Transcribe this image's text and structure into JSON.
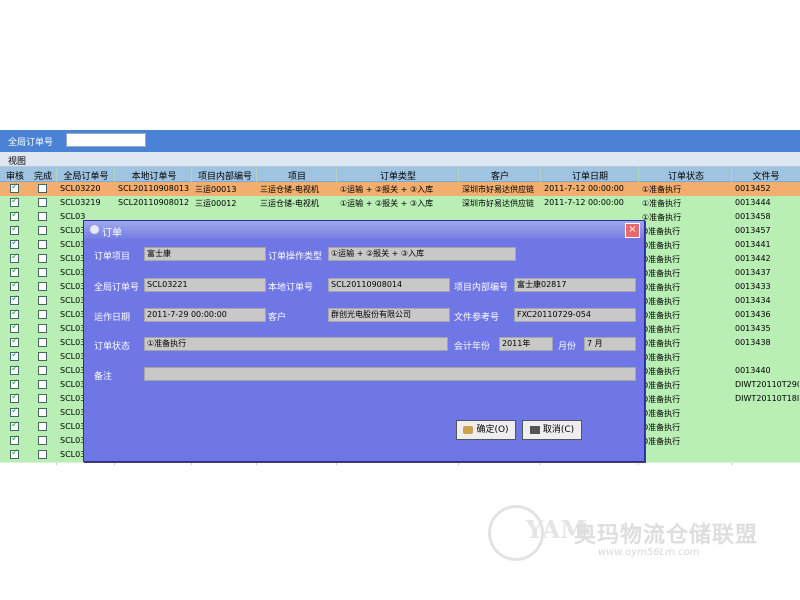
{
  "toolbar": {
    "label": "全局订单号",
    "value": ""
  },
  "menu": {
    "view": "视图"
  },
  "grid": {
    "columns": [
      "审核",
      "完成",
      "全局订单号",
      "本地订单号",
      "项目内部编号",
      "项目",
      "订单类型",
      "客户",
      "订单日期",
      "订单状态",
      "文件号"
    ],
    "rows": [
      {
        "audit": true,
        "done": false,
        "global": "SCL03220",
        "local": "SCL20110908013",
        "proj_no": "三运00013",
        "project": "三运仓储-电视机",
        "type": "①运输 + ②报关 + ③入库",
        "customer": "深圳市好易达供应链",
        "date": "2011-7-12 00:00:00",
        "status": "①准备执行",
        "file": "0013452"
      },
      {
        "audit": true,
        "done": false,
        "global": "SCL03219",
        "local": "SCL20110908012",
        "proj_no": "三运00012",
        "project": "三运仓储-电视机",
        "type": "①运输 + ②报关 + ③入库",
        "customer": "深圳市好易达供应链",
        "date": "2011-7-12 00:00:00",
        "status": "①准备执行",
        "file": "0013444"
      },
      {
        "audit": true,
        "done": false,
        "global": "SCL03",
        "local": "",
        "proj_no": "",
        "project": "",
        "type": "",
        "customer": "",
        "date": "",
        "status": "①准备执行",
        "file": "0013458"
      },
      {
        "audit": true,
        "done": false,
        "global": "SCL03",
        "local": "",
        "proj_no": "",
        "project": "",
        "type": "",
        "customer": "",
        "date": "",
        "status": "D准备执行",
        "file": "0013457"
      },
      {
        "audit": true,
        "done": false,
        "global": "SCL03",
        "local": "",
        "proj_no": "",
        "project": "",
        "type": "",
        "customer": "",
        "date": "",
        "status": "D准备执行",
        "file": "0013441"
      },
      {
        "audit": true,
        "done": false,
        "global": "SCL03",
        "local": "",
        "proj_no": "",
        "project": "",
        "type": "",
        "customer": "",
        "date": "",
        "status": "D准备执行",
        "file": "0013442"
      },
      {
        "audit": true,
        "done": false,
        "global": "SCL03",
        "local": "",
        "proj_no": "",
        "project": "",
        "type": "",
        "customer": "",
        "date": "",
        "status": "D准备执行",
        "file": "0013437"
      },
      {
        "audit": true,
        "done": false,
        "global": "SCL03",
        "local": "",
        "proj_no": "",
        "project": "",
        "type": "",
        "customer": "",
        "date": "",
        "status": "D准备执行",
        "file": "0013433"
      },
      {
        "audit": true,
        "done": false,
        "global": "SCL03",
        "local": "",
        "proj_no": "",
        "project": "",
        "type": "",
        "customer": "",
        "date": "",
        "status": "D准备执行",
        "file": "0013434"
      },
      {
        "audit": true,
        "done": false,
        "global": "SCL03",
        "local": "",
        "proj_no": "",
        "project": "",
        "type": "",
        "customer": "",
        "date": "",
        "status": "D准备执行",
        "file": "0013436"
      },
      {
        "audit": true,
        "done": false,
        "global": "SCL03",
        "local": "",
        "proj_no": "",
        "project": "",
        "type": "",
        "customer": "",
        "date": "",
        "status": "D准备执行",
        "file": "0013435"
      },
      {
        "audit": true,
        "done": false,
        "global": "SCL03",
        "local": "",
        "proj_no": "",
        "project": "",
        "type": "",
        "customer": "",
        "date": "",
        "status": "D准备执行",
        "file": "0013438"
      },
      {
        "audit": true,
        "done": false,
        "global": "SCL03",
        "local": "",
        "proj_no": "",
        "project": "",
        "type": "",
        "customer": "",
        "date": "",
        "status": "D准备执行",
        "file": ""
      },
      {
        "audit": true,
        "done": false,
        "global": "SCL03",
        "local": "",
        "proj_no": "",
        "project": "",
        "type": "",
        "customer": "",
        "date": "",
        "status": "D准备执行",
        "file": "0013440"
      },
      {
        "audit": true,
        "done": false,
        "global": "SCL03",
        "local": "",
        "proj_no": "",
        "project": "",
        "type": "",
        "customer": "",
        "date": "",
        "status": "D准备执行",
        "file": "DIWT20110T290-"
      },
      {
        "audit": true,
        "done": false,
        "global": "SCL03",
        "local": "",
        "proj_no": "",
        "project": "",
        "type": "",
        "customer": "",
        "date": "",
        "status": "D准备执行",
        "file": "DIWT20110T18I-"
      },
      {
        "audit": true,
        "done": false,
        "global": "SCL03",
        "local": "",
        "proj_no": "",
        "project": "",
        "type": "",
        "customer": "",
        "date": "",
        "status": "D准备执行",
        "file": ""
      },
      {
        "audit": true,
        "done": false,
        "global": "SCL03",
        "local": "",
        "proj_no": "",
        "project": "",
        "type": "",
        "customer": "",
        "date": "",
        "status": "D准备执行",
        "file": ""
      },
      {
        "audit": true,
        "done": false,
        "global": "SCL03",
        "local": "",
        "proj_no": "",
        "project": "",
        "type": "",
        "customer": "",
        "date": "",
        "status": "D准备执行",
        "file": ""
      },
      {
        "audit": true,
        "done": false,
        "global": "SCL03",
        "local": "",
        "proj_no": "",
        "project": "",
        "type": "",
        "customer": "",
        "date": "",
        "status": "",
        "file": ""
      }
    ]
  },
  "dialog": {
    "title": "订单",
    "close_label": "×",
    "fields": {
      "order_project": {
        "label": "订单项目",
        "value": "富士康"
      },
      "op_type": {
        "label": "订单操作类型",
        "value": "①运输 + ②报关 + ③入库"
      },
      "global_no": {
        "label": "全局订单号",
        "value": "SCL03221"
      },
      "local_no": {
        "label": "本地订单号",
        "value": "SCL20110908014"
      },
      "proj_internal": {
        "label": "项目内部编号",
        "value": "富士康02817"
      },
      "ship_date": {
        "label": "运作日期",
        "value": "2011-7-29 00:00:00"
      },
      "customer": {
        "label": "客户",
        "value": "群创光电股份有限公司"
      },
      "file_ref": {
        "label": "文件参考号",
        "value": "FXC20110729-054"
      },
      "status": {
        "label": "订单状态",
        "value": "①准备执行"
      },
      "fiscal_year": {
        "label": "会计年份",
        "value": "2011年"
      },
      "month": {
        "label": "月份",
        "value": "7 月"
      },
      "remark": {
        "label": "备注",
        "value": ""
      }
    },
    "ok_label": "确定(O)",
    "cancel_label": "取消(C)"
  },
  "watermark": {
    "logo": "YAM",
    "name": "奥玛物流仓储联盟",
    "url": "www.oym56Lm.com"
  }
}
